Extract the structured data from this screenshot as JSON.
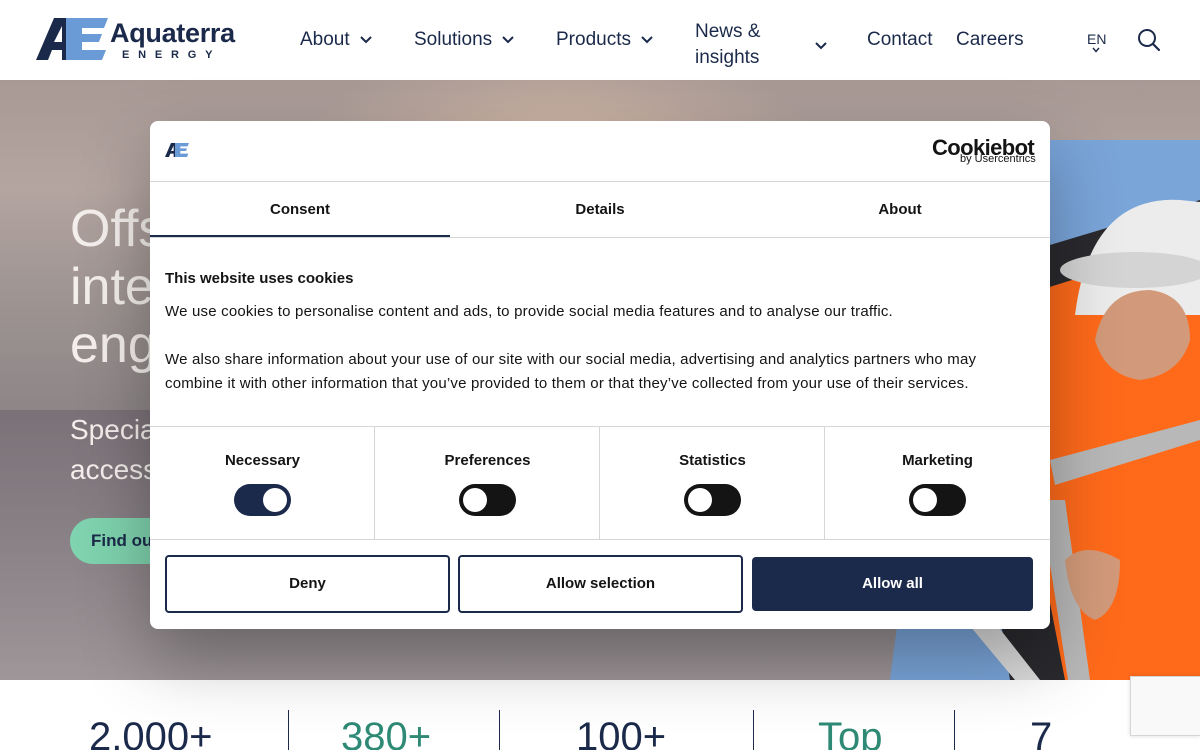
{
  "header": {
    "logo_name": "Aquaterra",
    "logo_sub": "ENERGY",
    "nav": [
      {
        "label": "About"
      },
      {
        "label": "Solutions"
      },
      {
        "label": "Products"
      },
      {
        "label_line1": "News &",
        "label_line2": "insights"
      },
      {
        "label": "Contact"
      },
      {
        "label": "Careers"
      }
    ],
    "language": "EN"
  },
  "hero": {
    "title_line1": "Offs",
    "title_line2": "inte",
    "title_line3": "eng",
    "subtitle_line1": "Specia",
    "subtitle_line2": "access",
    "cta": "Find ou"
  },
  "stats": [
    "2,000+",
    "380+",
    "100+",
    "Top",
    "7"
  ],
  "cookie_dialog": {
    "brand": "Cookiebot",
    "brand_sub": "by Usercentrics",
    "tabs": [
      "Consent",
      "Details",
      "About"
    ],
    "heading": "This website uses cookies",
    "paragraph1": "We use cookies to personalise content and ads, to provide social media features and to analyse our traffic.",
    "paragraph2": "We also share information about your use of our site with our social media, advertising and analytics partners who may combine it with other information that you’ve provided to them or that they’ve collected from your use of their services.",
    "categories": [
      {
        "label": "Necessary",
        "enabled": true
      },
      {
        "label": "Preferences",
        "enabled": false
      },
      {
        "label": "Statistics",
        "enabled": false
      },
      {
        "label": "Marketing",
        "enabled": false
      }
    ],
    "buttons": {
      "deny": "Deny",
      "allow_selection": "Allow selection",
      "allow_all": "Allow all"
    }
  },
  "colors": {
    "navy": "#1b2a4a",
    "teal": "#7fd3ae",
    "logo_blue": "#6b9bd6"
  }
}
